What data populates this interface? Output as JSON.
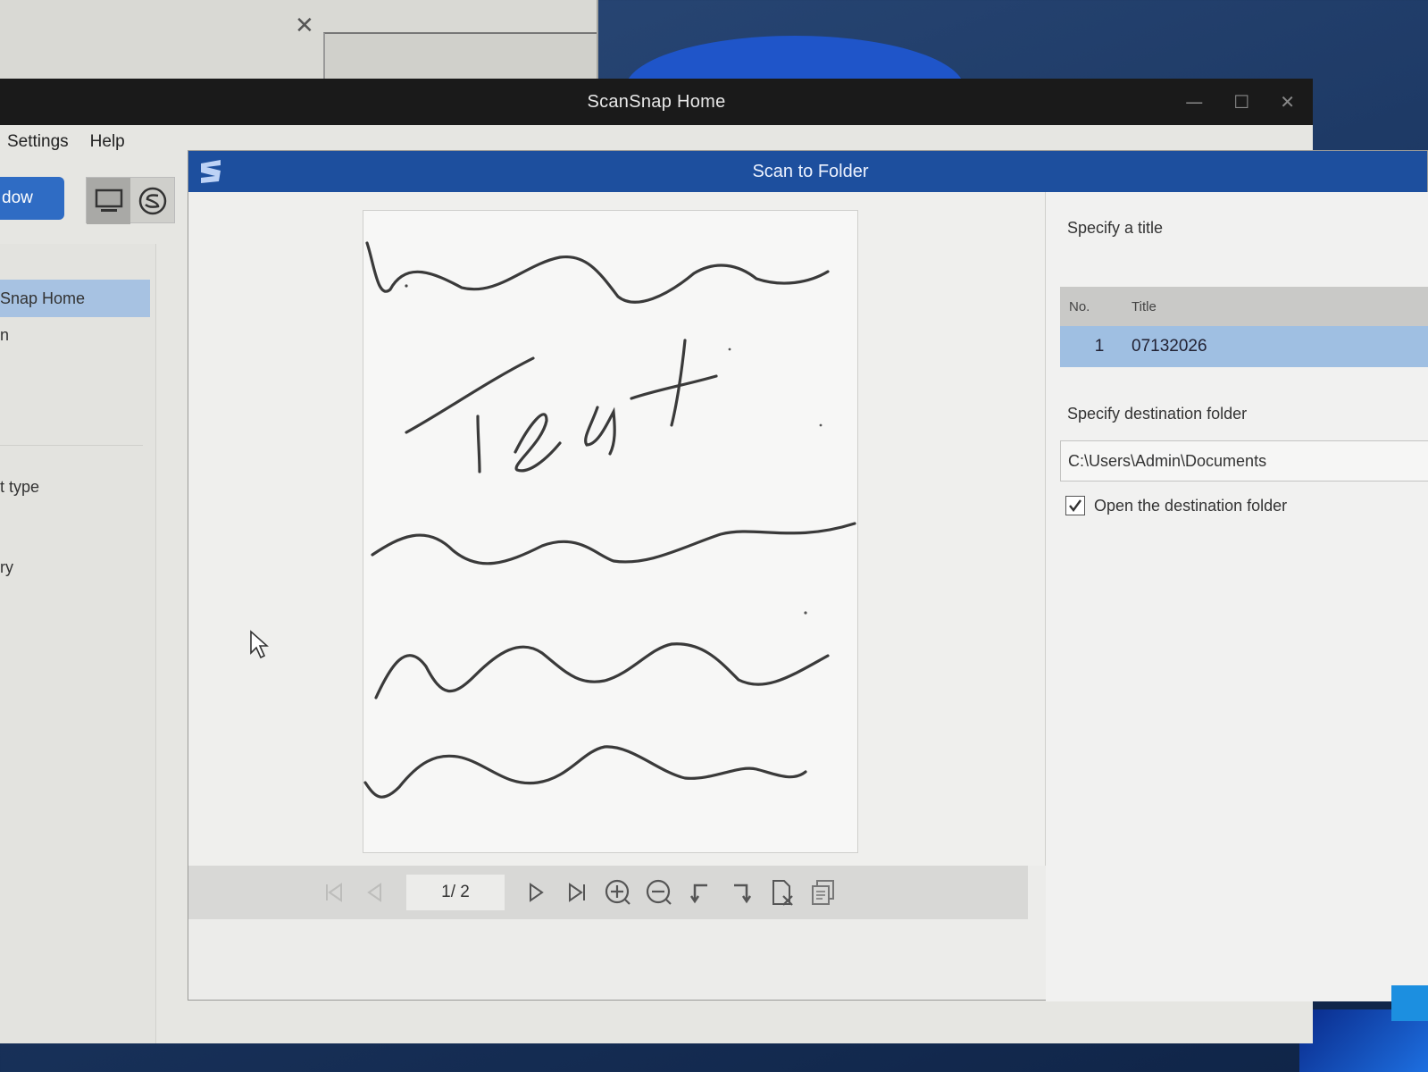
{
  "main_window": {
    "title": "ScanSnap Home",
    "menu": [
      "Settings",
      "Help"
    ],
    "scan_button_label": "dow",
    "sidebar": {
      "active_item": "Snap Home",
      "items": [
        "n",
        "t type",
        "ry"
      ]
    }
  },
  "dialog": {
    "title": "Scan to Folder",
    "page_indicator": "1/  2",
    "right_panel": {
      "title_label": "Specify a title",
      "table": {
        "headers": [
          "No.",
          "Title"
        ],
        "rows": [
          {
            "no": "1",
            "title": "07132026"
          }
        ]
      },
      "destination_label": "Specify destination folder",
      "destination_path": "C:\\Users\\Admin\\Documents",
      "open_folder_label": "Open the destination folder",
      "open_folder_checked": true
    }
  },
  "colors": {
    "dialog_titlebar": "#1d4f9e",
    "main_titlebar": "#1a1a1a",
    "selected_row": "#9fbfe2",
    "sidebar_active": "#a7c2e2",
    "scan_button": "#2f6cc4"
  }
}
